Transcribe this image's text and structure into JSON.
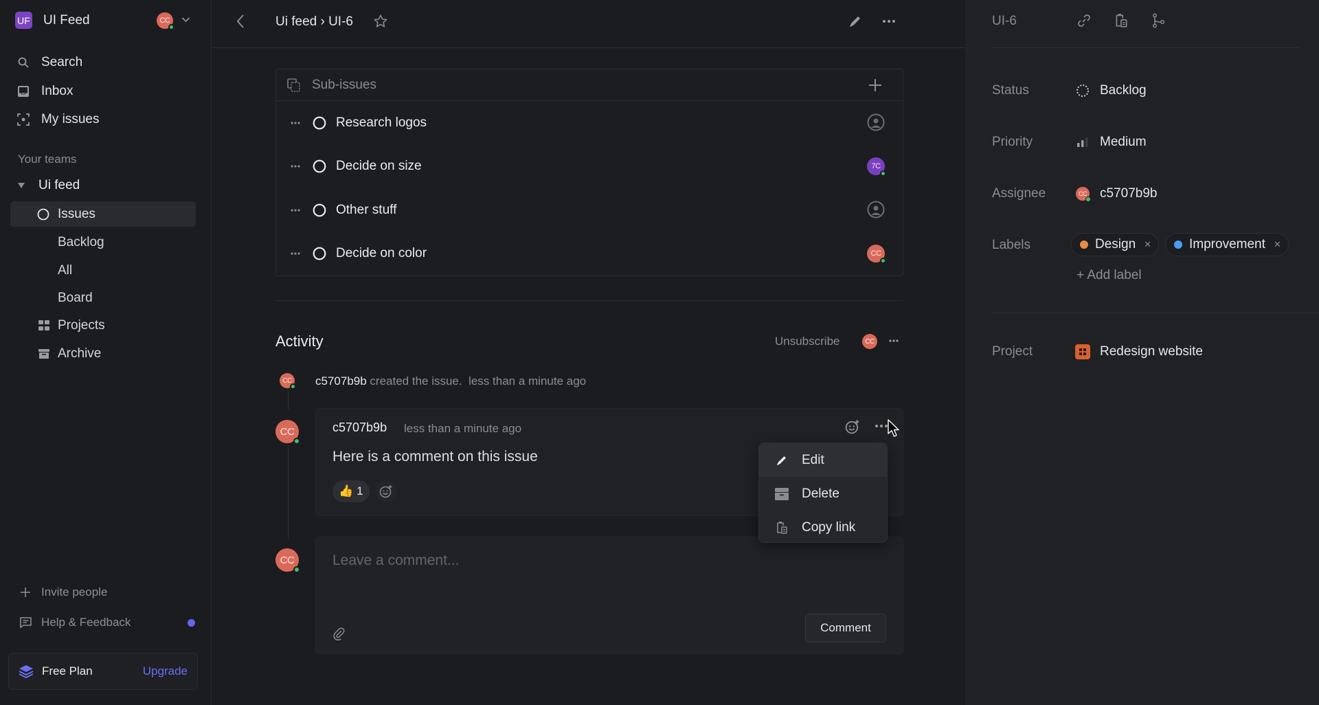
{
  "workspace": {
    "logo_initials": "UF",
    "name": "UI Feed",
    "user_initials": "CC"
  },
  "sidebar": {
    "nav": [
      {
        "label": "Search",
        "icon": "search-icon"
      },
      {
        "label": "Inbox",
        "icon": "inbox-icon"
      },
      {
        "label": "My issues",
        "icon": "my-issues-icon"
      }
    ],
    "teams_label": "Your teams",
    "team_name": "Ui feed",
    "issues_label": "Issues",
    "issue_views": [
      "Backlog",
      "All",
      "Board"
    ],
    "projects_label": "Projects",
    "archive_label": "Archive",
    "invite_label": "Invite people",
    "help_label": "Help & Feedback",
    "plan_label": "Free Plan",
    "upgrade_label": "Upgrade"
  },
  "header": {
    "breadcrumb": "Ui feed › UI-6"
  },
  "sub_issues": {
    "title": "Sub-issues",
    "items": [
      {
        "title": "Research logos",
        "assignee": null
      },
      {
        "title": "Decide on size",
        "assignee": "7C",
        "assignee_color": "#7a3fc1"
      },
      {
        "title": "Other stuff",
        "assignee": null
      },
      {
        "title": "Decide on color",
        "assignee": "CC",
        "assignee_color": "#d96a5a"
      }
    ]
  },
  "activity": {
    "title": "Activity",
    "unsubscribe_label": "Unsubscribe",
    "subscriber_initials": "CC",
    "event": {
      "user": "c5707b9b",
      "action": "created the issue.",
      "time": "less than a minute ago",
      "avatar_initials": "CC"
    },
    "comment": {
      "author": "c5707b9b",
      "time": "less than a minute ago",
      "body": "Here is a comment on this issue",
      "avatar_initials": "CC",
      "reaction_emoji": "👍",
      "reaction_count": "1"
    },
    "context_menu": [
      {
        "label": "Edit",
        "icon": "pencil-icon"
      },
      {
        "label": "Delete",
        "icon": "archive-box-icon"
      },
      {
        "label": "Copy link",
        "icon": "clipboard-icon"
      }
    ],
    "composer": {
      "placeholder": "Leave a comment...",
      "avatar_initials": "CC",
      "submit_label": "Comment"
    }
  },
  "panel": {
    "issue_id": "UI-6",
    "status_label": "Status",
    "status_value": "Backlog",
    "priority_label": "Priority",
    "priority_value": "Medium",
    "assignee_label": "Assignee",
    "assignee_value": "c5707b9b",
    "assignee_initials": "CC",
    "labels_label": "Labels",
    "labels": [
      {
        "name": "Design",
        "color": "#eb8a45"
      },
      {
        "name": "Improvement",
        "color": "#4a9cf5"
      }
    ],
    "add_label": "+ Add label",
    "project_label": "Project",
    "project_value": "Redesign website",
    "project_color": "#d9612c"
  },
  "colors": {
    "accent": "#6366f1",
    "online": "#3fbf6a"
  }
}
